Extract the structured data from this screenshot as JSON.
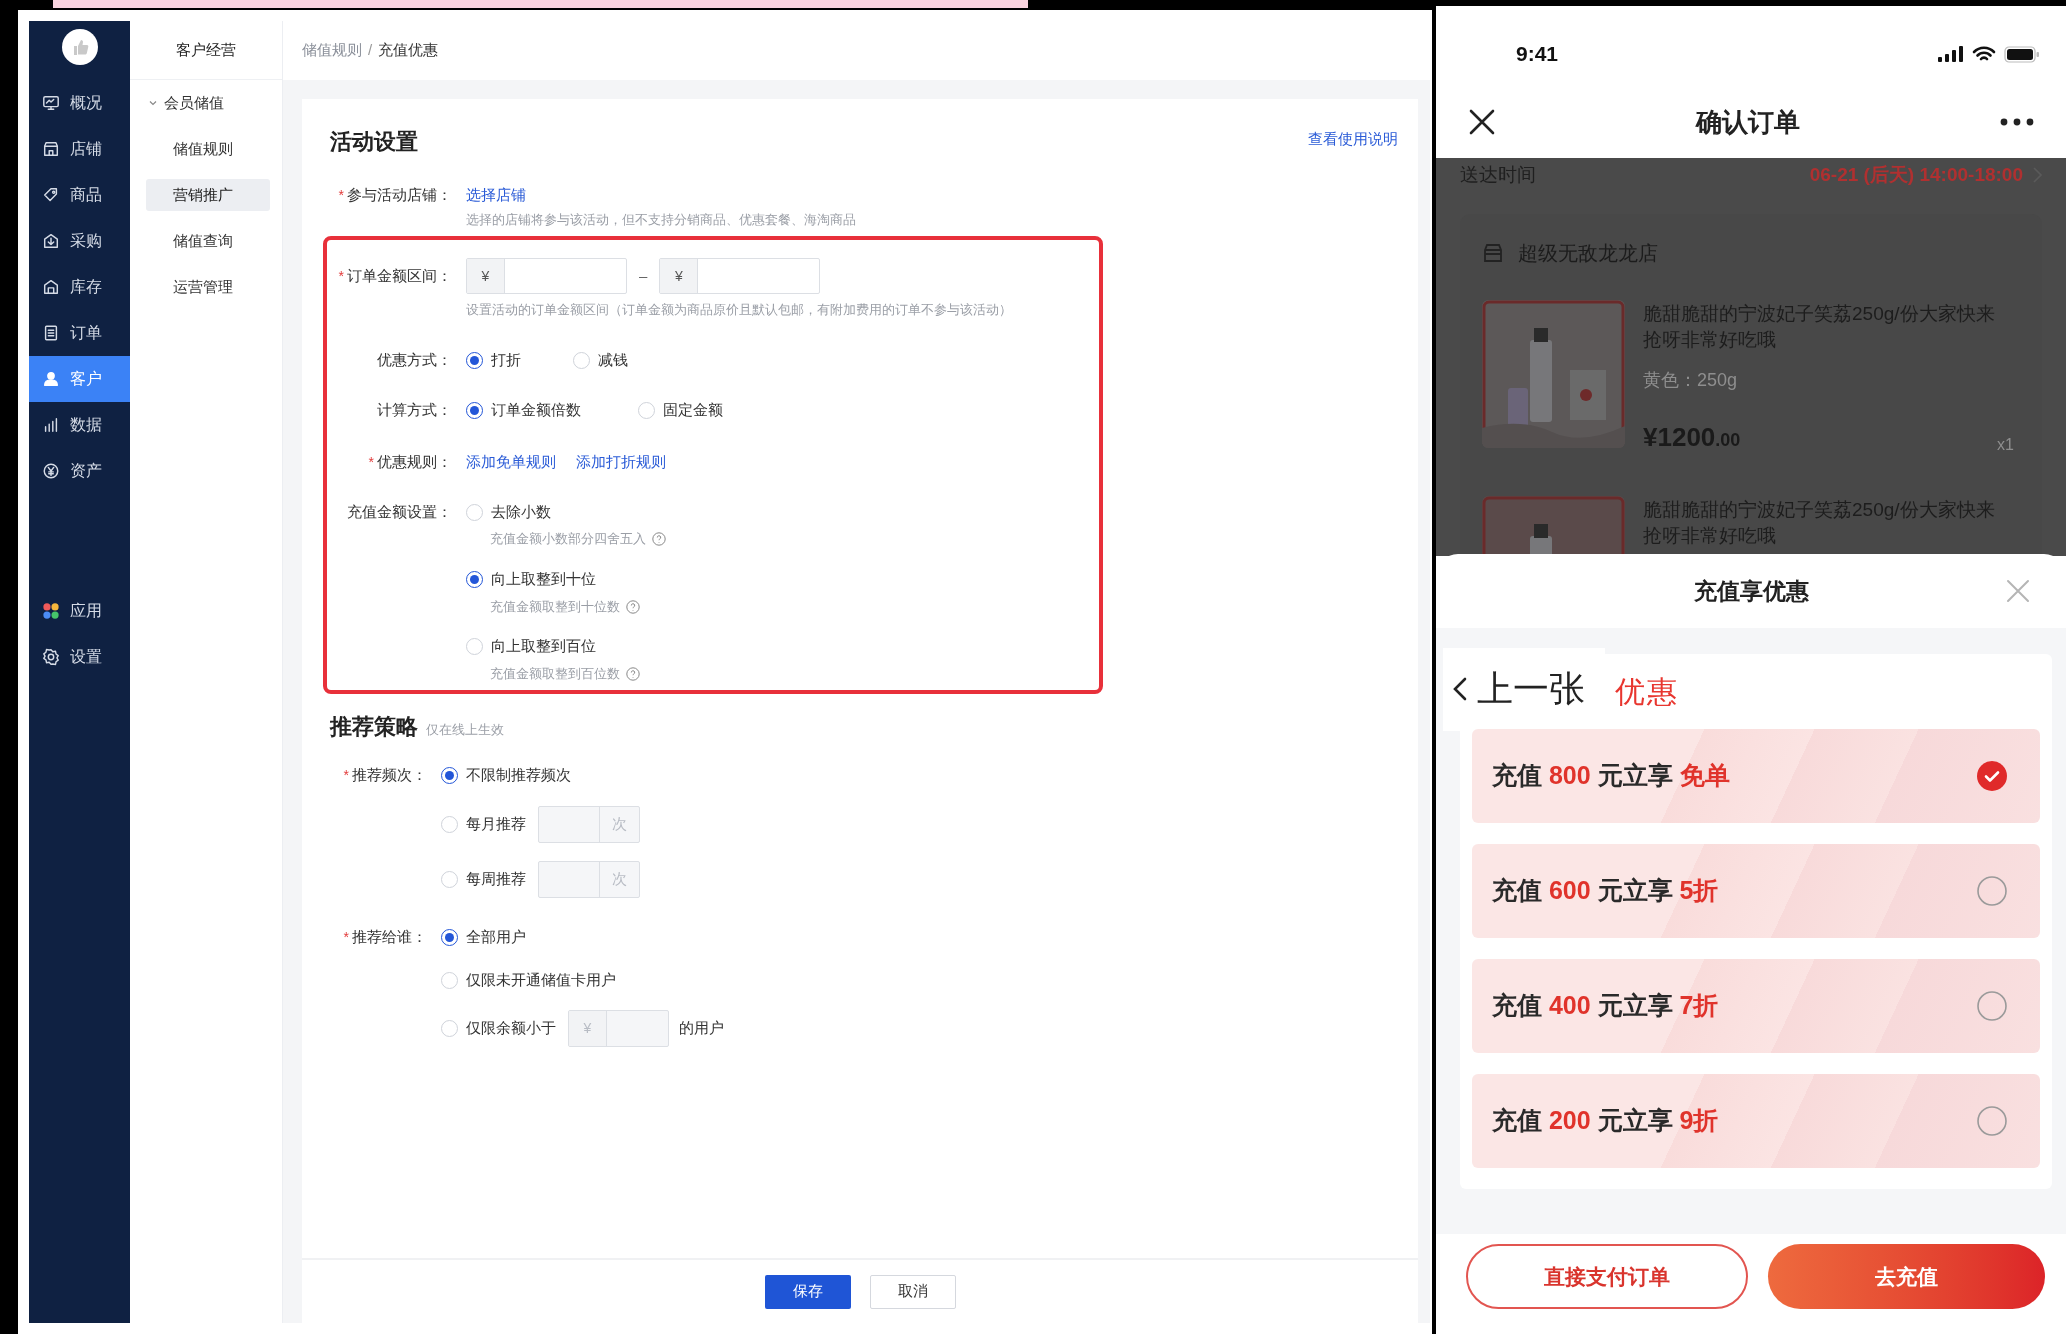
{
  "sidebar": {
    "items": [
      {
        "label": "概况",
        "selected": false
      },
      {
        "label": "店铺",
        "selected": false
      },
      {
        "label": "商品",
        "selected": false
      },
      {
        "label": "采购",
        "selected": false
      },
      {
        "label": "库存",
        "selected": false
      },
      {
        "label": "订单",
        "selected": false
      },
      {
        "label": "客户",
        "selected": true
      },
      {
        "label": "数据",
        "selected": false
      },
      {
        "label": "资产",
        "selected": false
      }
    ],
    "bottom_items": [
      {
        "label": "应用",
        "selected": false
      },
      {
        "label": "设置",
        "selected": false
      }
    ]
  },
  "subnav": {
    "title": "客户经营",
    "groups": [
      {
        "label": "会员储值",
        "expanded": true,
        "children": [
          {
            "label": "储值规则",
            "selected": false
          },
          {
            "label": "营销推广",
            "selected": true
          },
          {
            "label": "储值查询",
            "selected": false
          },
          {
            "label": "运营管理",
            "selected": false
          }
        ]
      }
    ]
  },
  "breadcrumb": {
    "items": [
      "储值规则",
      "充值优惠"
    ],
    "separator": "/"
  },
  "activity": {
    "title": "活动设置",
    "help_link": "查看使用说明",
    "fields": [
      {
        "kind": "links",
        "label": "参与活动店铺：",
        "required_mark": "*",
        "links": [
          "选择店铺"
        ],
        "hint": "选择的店铺将参与该活动，但不支持分销商品、优惠套餐、海淘商品"
      }
    ],
    "highlighted_fields": [
      {
        "kind": "range",
        "label": "订单金额区间：",
        "required_mark": "*",
        "prefix": "¥",
        "separator": "–",
        "prefix_2": "¥",
        "hint": "设置活动的订单金额区间（订单金额为商品原价且默认包邮，有附加费用的订单不参与该活动）"
      },
      {
        "kind": "radio_inline",
        "label": "优惠方式：",
        "options": [
          {
            "label": "打折",
            "selected": true
          },
          {
            "label": "减钱",
            "selected": false
          }
        ]
      },
      {
        "kind": "radio_inline",
        "label": "计算方式：",
        "options": [
          {
            "label": "订单金额倍数",
            "selected": true
          },
          {
            "label": "固定金额",
            "selected": false
          }
        ]
      },
      {
        "kind": "links",
        "label": "优惠规则：",
        "required_mark": "*",
        "links": [
          "添加免单规则",
          "添加打折规则"
        ]
      },
      {
        "kind": "radio_stack",
        "label": "充值金额设置：",
        "options": [
          {
            "label": "去除小数",
            "hint": "充值金额小数部分四舍五入",
            "selected": false
          },
          {
            "label": "向上取整到十位",
            "hint": "充值金额取整到十位数",
            "selected": true
          },
          {
            "label": "向上取整到百位",
            "hint": "充值金额取整到百位数",
            "selected": false
          }
        ]
      }
    ]
  },
  "recommendation": {
    "title": "推荐策略",
    "note": "仅在线上生效",
    "fields": [
      {
        "label": "推荐频次：",
        "required_mark": "*",
        "options": [
          {
            "label": "不限制推荐频次",
            "selected": true
          },
          {
            "label": "每月推荐",
            "selected": false,
            "suffix": "次"
          },
          {
            "label": "每周推荐",
            "selected": false,
            "suffix": "次"
          }
        ]
      },
      {
        "label": "推荐给谁：",
        "required_mark": "*",
        "options": [
          {
            "label": "全部用户",
            "selected": true
          },
          {
            "label": "仅限未开通储值卡用户",
            "selected": false
          },
          {
            "label": "仅限余额小于",
            "selected": false,
            "prefix": "¥",
            "after": "的用户"
          }
        ]
      }
    ]
  },
  "footer": {
    "buttons": [
      {
        "label": "保存",
        "primary": true
      },
      {
        "label": "取消",
        "primary": false
      }
    ]
  },
  "phone": {
    "status_bar": {
      "time": "9:41"
    },
    "header": {
      "title": "确认订单"
    },
    "order": {
      "delivery_label": "送达时间",
      "delivery_time": "06-21 (后天) 14:00-18:00",
      "store": "超级无敌龙龙店",
      "products": [
        {
          "title": "脆甜脆甜的宁波妃子笑荔250g/份大家快来抢呀非常好吃哦",
          "spec": "黄色：250g",
          "price": "¥1200",
          "price_decimals": ".00",
          "quantity": "x1"
        },
        {
          "title": "脆甜脆甜的宁波妃子笑荔250g/份大家快来抢呀非常好吃哦"
        }
      ]
    },
    "sheet": {
      "title": "充值享优惠",
      "previous": "上一张",
      "section_title": "优惠",
      "options": [
        {
          "prefix": "充值",
          "amount": "800",
          "middle": "元立享",
          "benefit": "免单",
          "selected": true
        },
        {
          "prefix": "充值",
          "amount": "600",
          "middle": "元立享",
          "benefit": "5折",
          "selected": false
        },
        {
          "prefix": "充值",
          "amount": "400",
          "middle": "元立享",
          "benefit": "7折",
          "selected": false
        },
        {
          "prefix": "充值",
          "amount": "200",
          "middle": "元立享",
          "benefit": "9折",
          "selected": false
        }
      ],
      "buttons": [
        {
          "label": "直接支付订单",
          "primary": false
        },
        {
          "label": "去充值",
          "primary": true
        }
      ]
    }
  }
}
